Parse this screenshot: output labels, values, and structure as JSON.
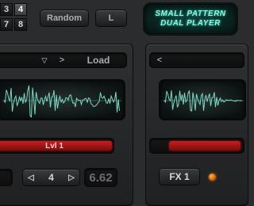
{
  "pattern_grid": {
    "rows": [
      [
        "3",
        "4"
      ],
      [
        "7",
        "8"
      ]
    ],
    "selected": "3"
  },
  "header": {
    "random_label": "Random",
    "l_label": "L",
    "title_line1": "SMALL PATTERN",
    "title_line2": "DUAL PLAYER"
  },
  "left_player": {
    "prev_glyph": "▽",
    "next_glyph": ">",
    "load_label": "Load",
    "level_label": "Lvl 1"
  },
  "right_player": {
    "prev_glyph": "<"
  },
  "footer": {
    "step_left_glyph": "◁",
    "step_value": "4",
    "step_right_glyph": "▷",
    "readout": "6.62",
    "fx_label": "FX 1"
  },
  "colors": {
    "waveform": "#7fd8c4",
    "level_bar": "#c81f1f",
    "title_text": "#8ff5e0",
    "led": "#ff8a1a"
  }
}
